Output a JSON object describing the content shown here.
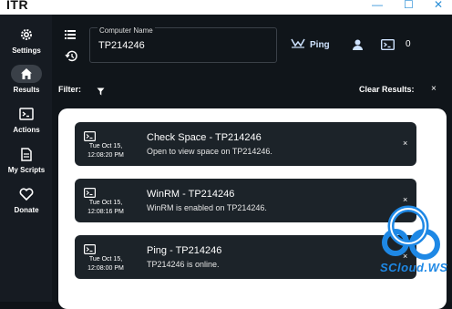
{
  "app": {
    "title": "ITR"
  },
  "window": {
    "minimize": "—",
    "maximize": "☐",
    "close": "✕"
  },
  "nav": {
    "items": [
      {
        "key": "settings",
        "label": "Settings",
        "icon": "gear-icon",
        "active": false
      },
      {
        "key": "results",
        "label": "Results",
        "icon": "home-icon",
        "active": true
      },
      {
        "key": "actions",
        "label": "Actions",
        "icon": "terminal-icon",
        "active": false
      },
      {
        "key": "my-scripts",
        "label": "My Scripts",
        "icon": "document-icon",
        "active": false
      },
      {
        "key": "donate",
        "label": "Donate",
        "icon": "heart-icon",
        "active": false
      }
    ]
  },
  "header": {
    "computer_caption": "Computer Name",
    "computer_value": "TP214246",
    "ping_label": "Ping",
    "count": "0"
  },
  "toolbar": {
    "filter_label": "Filter:",
    "clear_label": "Clear Results:",
    "clear_icon": "×"
  },
  "results": [
    {
      "date": "Tue Oct 15,",
      "time": "12:08:20 PM",
      "title": "Check Space - TP214246",
      "desc": "Open to view space on TP214246.",
      "close": "×"
    },
    {
      "date": "Tue Oct 15,",
      "time": "12:08:16 PM",
      "title": "WinRM - TP214246",
      "desc": "WinRM is enabled on TP214246.",
      "close": "×"
    },
    {
      "date": "Tue Oct 15,",
      "time": "12:08:00 PM",
      "title": "Ping - TP214246",
      "desc": "TP214246 is online.",
      "close": "×"
    }
  ],
  "watermark": {
    "text": "SCloud.WS"
  },
  "colors": {
    "accent": "#2b8fd6",
    "card": "#1c2329",
    "nav": "#161b22",
    "watermark": "#1e88e5"
  }
}
